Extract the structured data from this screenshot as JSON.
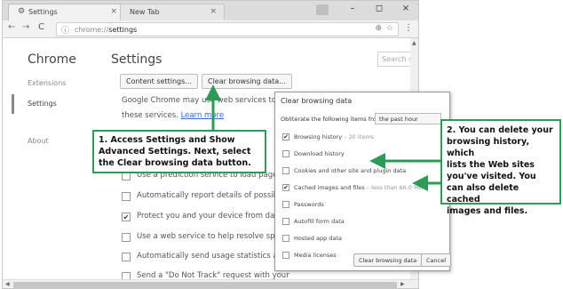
{
  "browser": {
    "tabs": [
      {
        "label": "Settings",
        "close": "×"
      },
      {
        "label": "New Tab",
        "close": "×"
      }
    ],
    "window_controls": {
      "minimize": "–",
      "maximize": "◻",
      "close": "×"
    },
    "nav": {
      "back": "←",
      "forward": "→",
      "reload": "C"
    },
    "address": {
      "scheme": "chrome://",
      "path": "settings"
    },
    "menu": "⋮"
  },
  "sidebar": {
    "title": "Chrome",
    "items": [
      {
        "label": "Extensions"
      },
      {
        "label": "Settings"
      },
      {
        "label": "About"
      }
    ]
  },
  "settings": {
    "title": "Settings",
    "search_placeholder": "Search s",
    "buttons": {
      "content_settings": "Content settings...",
      "clear_browsing_data": "Clear browsing data..."
    },
    "paragraph": {
      "line1": "Google Chrome may use web services to imp",
      "line2_prefix": "these services. ",
      "learn_more": "Learn more"
    },
    "checkboxes": [
      {
        "label": "Use a prediction service to load pages mo",
        "checked": false
      },
      {
        "label": "Automatically report details of possible se",
        "checked": false
      },
      {
        "label": "Protect you and your device from danger",
        "checked": true
      },
      {
        "label": "Use a web service to help resolve spelling",
        "checked": false
      },
      {
        "label": "Automatically send usage statistics and cr",
        "checked": false
      },
      {
        "label": "Send a \"Do Not Track\" request with your",
        "checked": false
      }
    ]
  },
  "dialog": {
    "title": "Clear browsing data",
    "obliterate_label": "Obliterate the following items from:",
    "time_range": "the past hour",
    "items": [
      {
        "label": "Browsing history",
        "note": " – 20 items",
        "checked": true
      },
      {
        "label": "Download history",
        "note": "",
        "checked": false
      },
      {
        "label": "Cookies and other site and plugin data",
        "note": "",
        "checked": false
      },
      {
        "label": "Cached images and files",
        "note": " – less than 66.0 MB",
        "checked": true
      },
      {
        "label": "Passwords",
        "note": "",
        "checked": false
      },
      {
        "label": "Autofill form data",
        "note": "",
        "checked": false
      },
      {
        "label": "Hosted app data",
        "note": "",
        "checked": false
      },
      {
        "label": "Media licenses",
        "note": "",
        "checked": false
      }
    ],
    "buttons": {
      "clear": "Clear browsing data",
      "cancel": "Cancel"
    }
  },
  "callouts": {
    "step1": [
      "1. Access Settings and Show",
      "Advanced Settings. Next, select",
      "the Clear browsing data button."
    ],
    "step2": [
      "2. You can delete your",
      "browsing history, which",
      "lists the Web sites",
      "you've visited. You",
      "can also delete cached",
      "images and files."
    ]
  },
  "colors": {
    "callout_border": "#2e9a57",
    "link": "#3367d6"
  }
}
